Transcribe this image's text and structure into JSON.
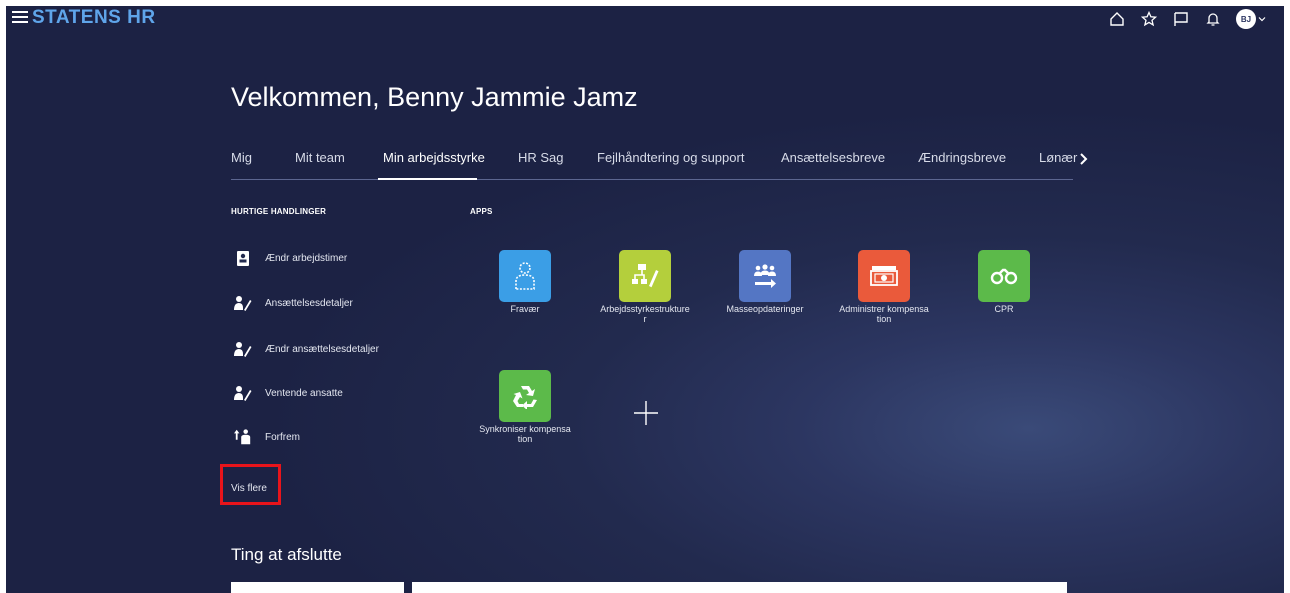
{
  "header": {
    "brand": "STATENS HR",
    "avatar_initials": "BJ"
  },
  "welcome": "Velkommen, Benny Jammie Jamz",
  "tabs": [
    {
      "label": "Mig"
    },
    {
      "label": "Mit team"
    },
    {
      "label": "Min arbejdsstyrke",
      "active": true
    },
    {
      "label": "HR Sag"
    },
    {
      "label": "Fejlhåndtering og support"
    },
    {
      "label": "Ansættelsesbreve"
    },
    {
      "label": "Ændringsbreve"
    },
    {
      "label": "Lønær"
    }
  ],
  "quick_actions": {
    "title": "HURTIGE HANDLINGER",
    "items": [
      {
        "label": "Ændr arbejdstimer",
        "icon": "id-badge-icon"
      },
      {
        "label": "Ansættelsesdetaljer",
        "icon": "person-edit-icon"
      },
      {
        "label": "Ændr ansættelsesdetaljer",
        "icon": "person-edit-icon"
      },
      {
        "label": "Ventende ansatte",
        "icon": "person-edit-icon"
      },
      {
        "label": "Forfrem",
        "icon": "promote-icon"
      }
    ],
    "more_label": "Vis flere"
  },
  "apps": {
    "title": "APPS",
    "items": [
      {
        "label": "Fravær",
        "color": "#3b9ee6",
        "icon": "absence-person-icon"
      },
      {
        "label": "Arbejdsstyrkestrukturer",
        "color": "#b4cf3c",
        "icon": "org-structure-icon"
      },
      {
        "label": "Masseopdateringer",
        "color": "#5476c4",
        "icon": "mass-update-icon"
      },
      {
        "label": "Administrer kompensation",
        "color": "#ea5a3b",
        "icon": "money-icon"
      },
      {
        "label": "CPR",
        "color": "#5cba4a",
        "icon": "binoculars-icon"
      },
      {
        "label": "Synkroniser kompensation",
        "color": "#5cba4a",
        "icon": "recycle-icon"
      }
    ],
    "add_icon": "plus-icon"
  },
  "things_to_finish": "Ting at afslutte",
  "colors": {
    "brand": "#5fa5ea",
    "background": "#222a4e",
    "highlight": "#e8141b"
  }
}
